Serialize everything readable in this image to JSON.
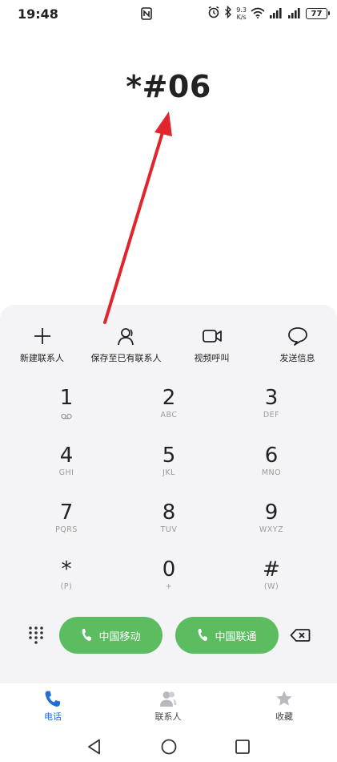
{
  "status_bar": {
    "time": "19:48",
    "network_speed_value": "9.3",
    "network_speed_unit": "K/s",
    "battery": "77"
  },
  "dialer": {
    "number": "*#06"
  },
  "actions": [
    {
      "label": "新建联系人",
      "icon": "plus-icon"
    },
    {
      "label": "保存至已有联系人",
      "icon": "person-icon"
    },
    {
      "label": "视频呼叫",
      "icon": "video-icon"
    },
    {
      "label": "发送信息",
      "icon": "message-icon"
    }
  ],
  "keypad": [
    {
      "digit": "1",
      "sub": ""
    },
    {
      "digit": "2",
      "sub": "ABC"
    },
    {
      "digit": "3",
      "sub": "DEF"
    },
    {
      "digit": "4",
      "sub": "GHI"
    },
    {
      "digit": "5",
      "sub": "JKL"
    },
    {
      "digit": "6",
      "sub": "MNO"
    },
    {
      "digit": "7",
      "sub": "PQRS"
    },
    {
      "digit": "8",
      "sub": "TUV"
    },
    {
      "digit": "9",
      "sub": "WXYZ"
    },
    {
      "digit": "*",
      "sub": "(P)"
    },
    {
      "digit": "0",
      "sub": "+"
    },
    {
      "digit": "#",
      "sub": "(W)"
    }
  ],
  "call_buttons": {
    "sim1": "中国移动",
    "sim2": "中国联通"
  },
  "tabs": [
    {
      "label": "电话",
      "active": true
    },
    {
      "label": "联系人",
      "active": false
    },
    {
      "label": "收藏",
      "active": false
    }
  ],
  "colors": {
    "call_green": "#5bbd60",
    "active_tab_blue": "#1e6fd9",
    "annotation_red": "#e0262c"
  }
}
